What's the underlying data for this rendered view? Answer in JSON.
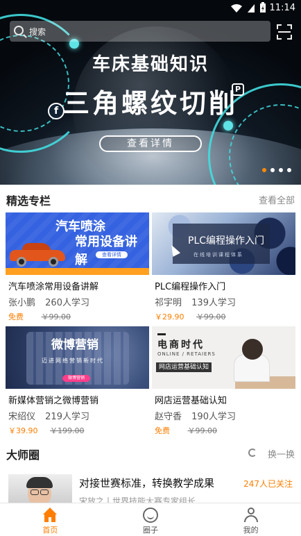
{
  "status_bar": {
    "time": "11:14"
  },
  "search": {
    "placeholder": "搜索"
  },
  "banner": {
    "title_line1": "车床基础知识",
    "title_line2": "三角螺纹切削",
    "detail_button": "查看详情",
    "slide_count": 4,
    "active_slide": 1
  },
  "featured": {
    "title": "精选专栏",
    "more": "查看全部",
    "courses": [
      {
        "thumb_line1": "汽车喷涂",
        "thumb_line2": "常用设备讲解",
        "thumb_pill": "查看详情",
        "title": "汽车喷涂常用设备讲解",
        "teacher": "张小鹏",
        "learners": "260人学习",
        "price": "免费",
        "original_price": "￥99.00"
      },
      {
        "thumb_line1": "PLC编程操作入门",
        "thumb_line2": "在线培训课程体系",
        "title": "PLC编程操作入门",
        "teacher": "祁宇明",
        "learners": "139人学习",
        "price": "￥29.90",
        "original_price": "￥99.00"
      },
      {
        "thumb_line1": "微博营销",
        "thumb_line2": "迈进网络营销新时代",
        "thumb_pill": "微博营销",
        "title": "新媒体营销之微博营销",
        "teacher": "宋绍仪",
        "learners": "219人学习",
        "price": "￥39.90",
        "original_price": "￥199.00"
      },
      {
        "thumb_line1": "电商时代",
        "thumb_line2": "ONLINE / RETAIERS",
        "thumb_tag": "网店运营基础认知",
        "title": "网店运营基础认知",
        "teacher": "赵守香",
        "learners": "190人学习",
        "price": "免费",
        "original_price": "￥99.00"
      }
    ]
  },
  "masters": {
    "title": "大师圈",
    "refresh": "换一换",
    "items": [
      {
        "title": "对接世赛标准，转换教学成果",
        "follow": "247人已关注",
        "subtitle": "宋放之丨世界技能大赛专家组长"
      }
    ]
  },
  "nav": {
    "items": [
      {
        "label": "首页",
        "icon": "home-icon",
        "active": true
      },
      {
        "label": "圈子",
        "icon": "circle-icon",
        "active": false
      },
      {
        "label": "我的",
        "icon": "user-icon",
        "active": false
      }
    ]
  },
  "colors": {
    "accent": "#ff7e00",
    "banner_cyan": "#42dde0"
  }
}
